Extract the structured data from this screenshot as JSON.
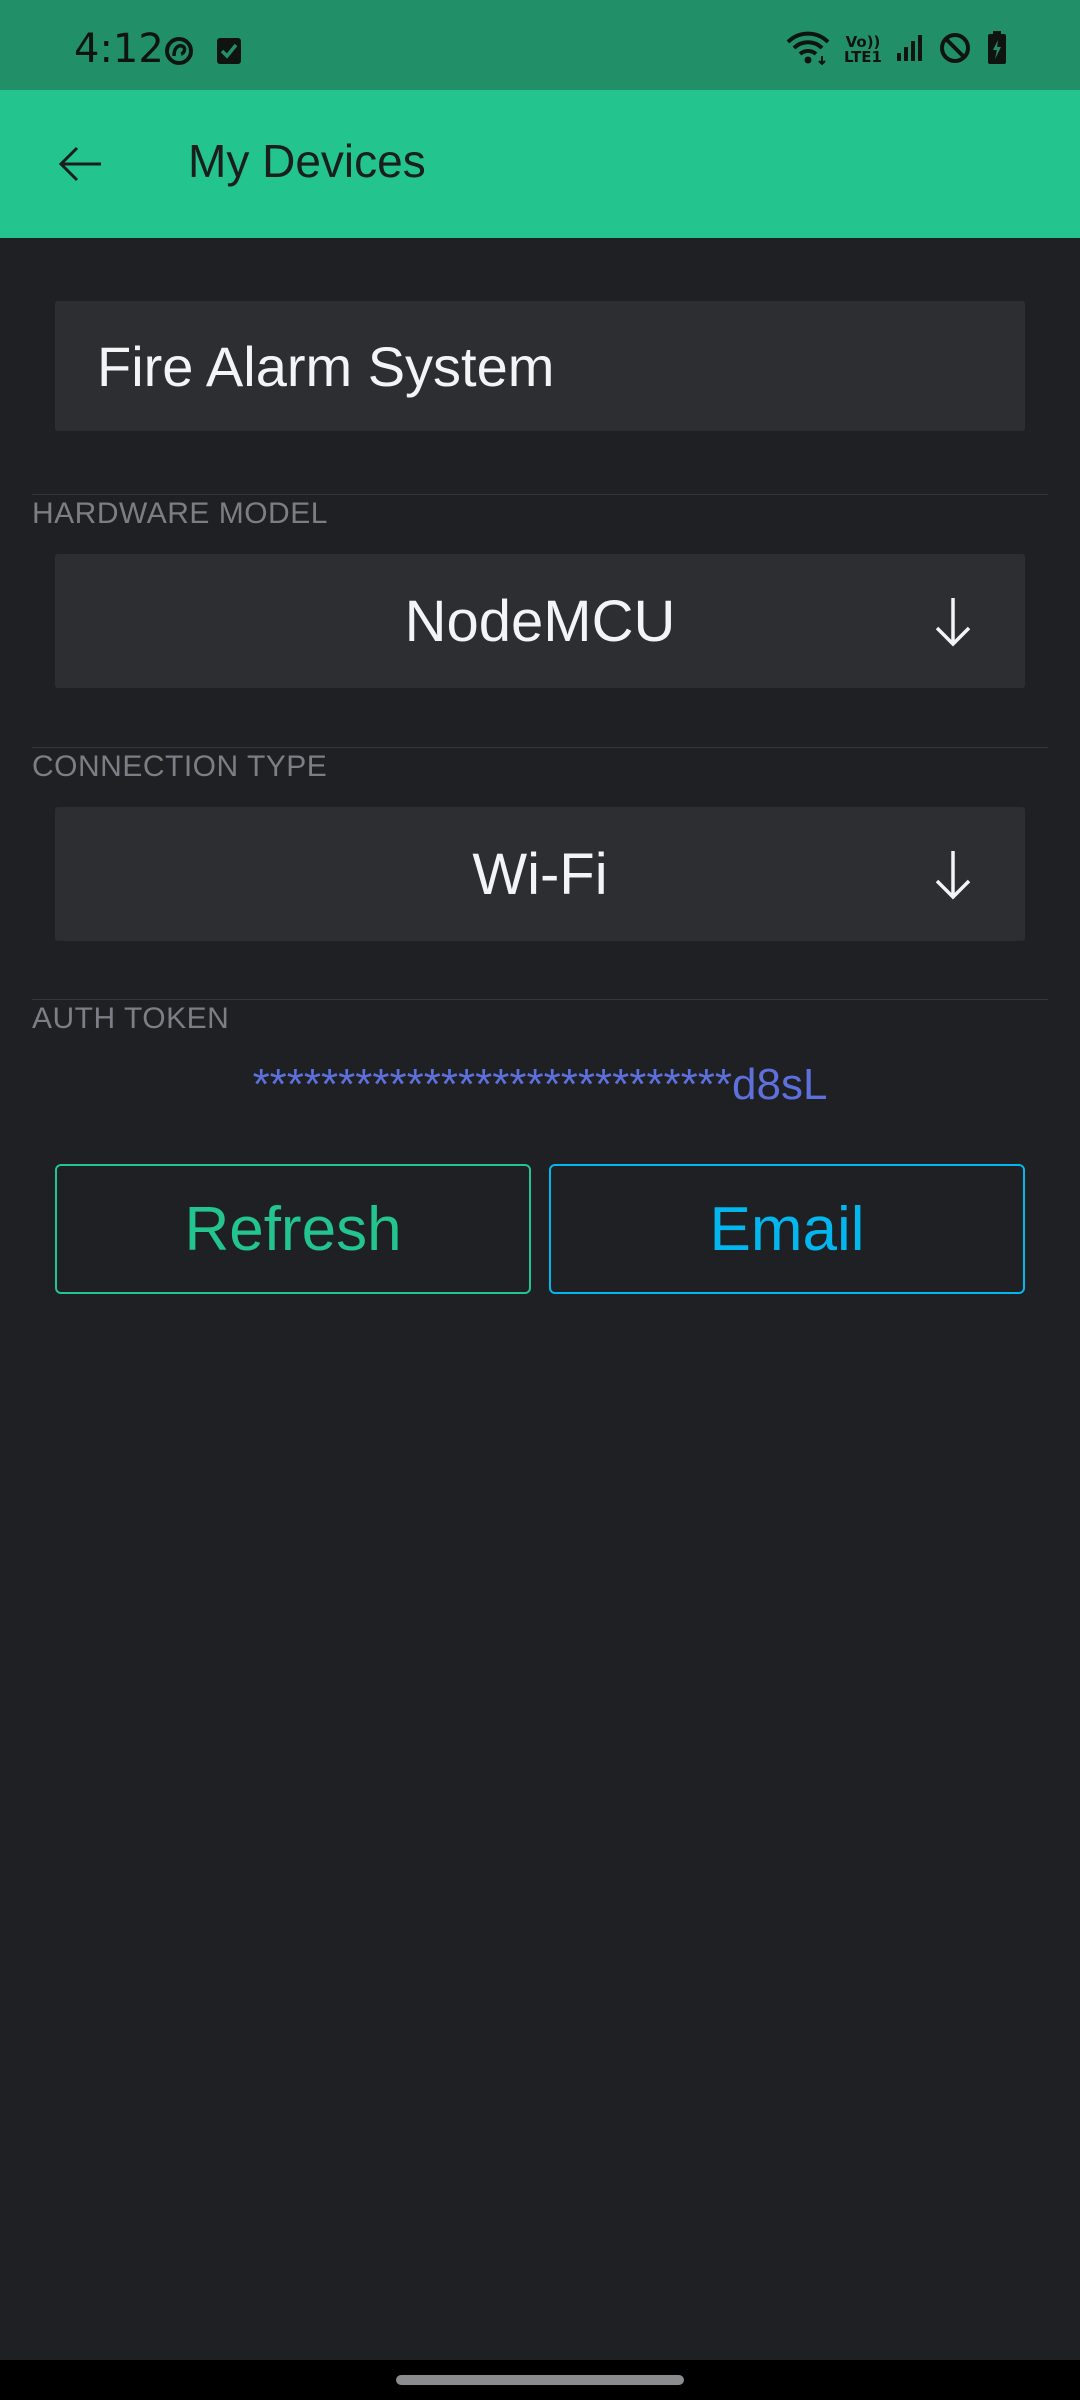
{
  "status_bar": {
    "time": "4:12",
    "icons": [
      "app-notification-icon",
      "checkbox-notification-icon",
      "wifi-icon",
      "volte-lte-icon",
      "signal-icon",
      "do-not-disturb-icon",
      "battery-icon"
    ],
    "volte_label_top": "Vo))",
    "volte_label_bottom": "LTE1"
  },
  "app_bar": {
    "title": "My Devices",
    "back_icon": "arrow-left-icon",
    "color": "#23c48e"
  },
  "device": {
    "name": "Fire Alarm System",
    "hardware_model_label": "HARDWARE MODEL",
    "hardware_model": "NodeMCU",
    "connection_type_label": "CONNECTION TYPE",
    "connection_type": "Wi-Fi",
    "auth_token_label": "AUTH TOKEN",
    "auth_token": "****************************d8sL"
  },
  "actions": {
    "refresh_label": "Refresh",
    "email_label": "Email",
    "refresh_color": "#23c48e",
    "email_color": "#04b6ee"
  },
  "colors": {
    "background": "#1f2023",
    "field": "#2d2e32",
    "token": "#5d70dc"
  }
}
